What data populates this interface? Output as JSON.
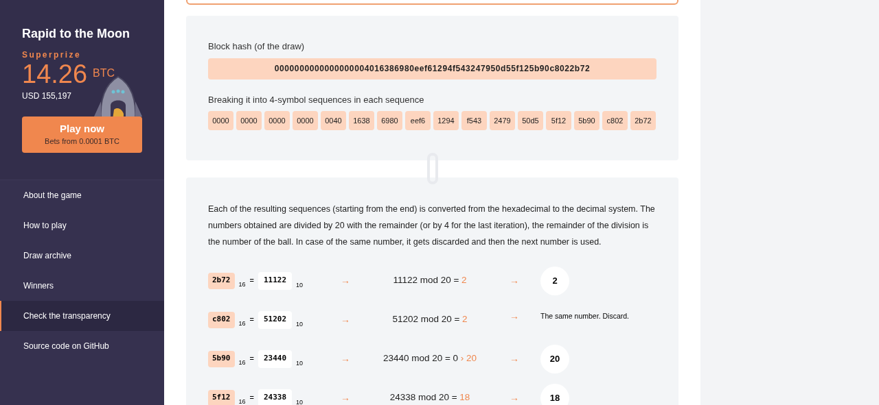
{
  "sidebar": {
    "title": "Rapid to the Moon",
    "prize_label": "Superprize",
    "prize_amount": "14.26",
    "prize_currency": "BTC",
    "prize_usd": "USD 155,197",
    "play_button": {
      "label": "Play now",
      "sublabel": "Bets from 0.0001 BTC"
    },
    "items": [
      {
        "label": "About the game",
        "selected": false
      },
      {
        "label": "How to play",
        "selected": false
      },
      {
        "label": "Draw archive",
        "selected": false
      },
      {
        "label": "Winners",
        "selected": false
      },
      {
        "label": "Check the transparency",
        "selected": true
      },
      {
        "label": "Source code on GitHub",
        "selected": false
      }
    ]
  },
  "hash_card": {
    "hash_label": "Block hash (of the draw)",
    "hash": "0000000000000000004016386980eef61294f543247950d55f125b90c8022b72",
    "split_label": "Breaking it into 4-symbol sequences in each sequence",
    "sequences": [
      "0000",
      "0000",
      "0000",
      "0000",
      "0040",
      "1638",
      "6980",
      "eef6",
      "1294",
      "f543",
      "2479",
      "50d5",
      "5f12",
      "5b90",
      "c802",
      "2b72"
    ]
  },
  "steps_card": {
    "description": "Each of the resulting sequences (starting from the end) is converted from the hexadecimal to the decimal system. The numbers obtained are divided by 20 with the remainder (or by 4 for the last iteration), the remainder of the division is the number of the ball. In case of the same number, it gets discarded and then the next number is used.",
    "steps": [
      {
        "hex": "2b72",
        "hex_base": "16",
        "equals": "=",
        "dec": "11122",
        "dec_base": "10",
        "arrows": [
          "→",
          "→"
        ],
        "expression": "11122 mod 20 = ",
        "result": "2",
        "outcome": {
          "kind": "ball",
          "text": "2"
        }
      },
      {
        "hex": "c802",
        "hex_base": "16",
        "equals": "=",
        "dec": "51202",
        "dec_base": "10",
        "arrows": [
          "→",
          "→"
        ],
        "expression": "51202 mod 20 = ",
        "result": "2",
        "outcome": {
          "kind": "note",
          "text": "The same number. Discard."
        }
      },
      {
        "hex": "5b90",
        "hex_base": "16",
        "equals": "=",
        "dec": "23440",
        "dec_base": "10",
        "arrows": [
          "→",
          "→"
        ],
        "expression": "23440 mod 20 = 0 ",
        "result": "› 20",
        "outcome": {
          "kind": "ball",
          "text": "20"
        }
      },
      {
        "hex": "5f12",
        "hex_base": "16",
        "equals": "=",
        "dec": "24338",
        "dec_base": "10",
        "arrows": [
          "→",
          "→"
        ],
        "expression": "24338 mod 20 = ",
        "result": "18",
        "outcome": {
          "kind": "ball",
          "text": "18"
        }
      }
    ]
  }
}
